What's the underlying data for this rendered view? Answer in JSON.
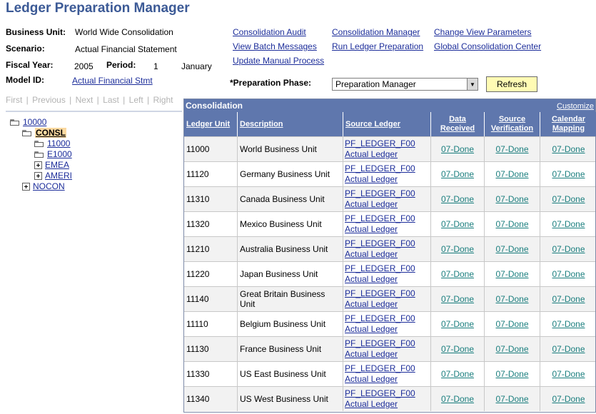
{
  "title": "Ledger Preparation Manager",
  "fields": {
    "business_unit_label": "Business Unit:",
    "business_unit_value": "World Wide Consolidation",
    "scenario_label": "Scenario:",
    "scenario_value": "Actual Financial Statement",
    "fiscal_year_label": "Fiscal Year:",
    "fiscal_year_value": "2005",
    "period_label": "Period:",
    "period_value": "1",
    "period_name": "January",
    "model_id_label": "Model ID:",
    "model_id_value": "Actual Financial Stmt"
  },
  "links": {
    "consolidation_audit": "Consolidation Audit",
    "view_batch_messages": "View Batch Messages",
    "update_manual_process": "Update Manual Process",
    "consolidation_manager": "Consolidation Manager",
    "run_ledger_preparation": "Run Ledger Preparation",
    "change_view_parameters": "Change View Parameters",
    "global_consolidation_center": "Global Consolidation Center"
  },
  "pager": {
    "first": "First",
    "previous": "Previous",
    "next": "Next",
    "last": "Last",
    "left": "Left",
    "right": "Right",
    "separator": "|"
  },
  "tree": {
    "root": "10000",
    "consl": "CONSL",
    "child_11000": "11000",
    "child_e1000": "E1000",
    "child_emea": "EMEA",
    "child_ameri": "AMERI",
    "nocon": "NOCON"
  },
  "phase": {
    "label": "*Preparation Phase:",
    "selected": "Preparation Manager",
    "refresh_label": "Refresh"
  },
  "grid": {
    "title": "Consolidation",
    "customize": "Customize",
    "headers": {
      "ledger_unit": "Ledger Unit",
      "description": "Description",
      "source_ledger": "Source Ledger",
      "data_received_1": "Data",
      "data_received_2": "Received",
      "source_verification_1": "Source",
      "source_verification_2": "Verification",
      "calendar_mapping_1": "Calendar",
      "calendar_mapping_2": "Mapping"
    },
    "rows": [
      {
        "unit": "11000",
        "desc": "World Business Unit",
        "src1": "PF_LEDGER_F00",
        "src2": "Actual Ledger",
        "data": "07-Done",
        "verif": "07-Done",
        "cal": "07-Done"
      },
      {
        "unit": "11120",
        "desc": "Germany Business Unit",
        "src1": "PF_LEDGER_F00",
        "src2": "Actual Ledger",
        "data": "07-Done",
        "verif": "07-Done",
        "cal": "07-Done"
      },
      {
        "unit": "11310",
        "desc": "Canada Business Unit",
        "src1": "PF_LEDGER_F00",
        "src2": "Actual Ledger",
        "data": "07-Done",
        "verif": "07-Done",
        "cal": "07-Done"
      },
      {
        "unit": "11320",
        "desc": "Mexico Business Unit",
        "src1": "PF_LEDGER_F00",
        "src2": "Actual Ledger",
        "data": "07-Done",
        "verif": "07-Done",
        "cal": "07-Done"
      },
      {
        "unit": "11210",
        "desc": "Australia Business Unit",
        "src1": "PF_LEDGER_F00",
        "src2": "Actual Ledger",
        "data": "07-Done",
        "verif": "07-Done",
        "cal": "07-Done"
      },
      {
        "unit": "11220",
        "desc": "Japan Business Unit",
        "src1": "PF_LEDGER_F00",
        "src2": "Actual Ledger",
        "data": "07-Done",
        "verif": "07-Done",
        "cal": "07-Done"
      },
      {
        "unit": "11140",
        "desc": "Great Britain Business Unit",
        "src1": "PF_LEDGER_F00",
        "src2": "Actual Ledger",
        "data": "07-Done",
        "verif": "07-Done",
        "cal": "07-Done"
      },
      {
        "unit": "11110",
        "desc": "Belgium Business Unit",
        "src1": "PF_LEDGER_F00",
        "src2": "Actual Ledger",
        "data": "07-Done",
        "verif": "07-Done",
        "cal": "07-Done"
      },
      {
        "unit": "11130",
        "desc": "France Business Unit",
        "src1": "PF_LEDGER_F00",
        "src2": "Actual Ledger",
        "data": "07-Done",
        "verif": "07-Done",
        "cal": "07-Done"
      },
      {
        "unit": "11330",
        "desc": "US East Business Unit",
        "src1": "PF_LEDGER_F00",
        "src2": "Actual Ledger",
        "data": "07-Done",
        "verif": "07-Done",
        "cal": "07-Done"
      },
      {
        "unit": "11340",
        "desc": "US West Business Unit",
        "src1": "PF_LEDGER_F00",
        "src2": "Actual Ledger",
        "data": "07-Done",
        "verif": "07-Done",
        "cal": "07-Done"
      }
    ]
  },
  "colors": {
    "title": "#3c5a96",
    "grid_header": "#5f77ad",
    "link": "#1c2d9a",
    "done_link": "#1a7e7e",
    "refresh_bg": "#fffbb4",
    "selected_node_bg": "#fbd9a0"
  },
  "icons": {
    "folder": "folder-icon",
    "expand": "plus-box-icon",
    "dropdown": "dropdown-arrow-icon"
  }
}
